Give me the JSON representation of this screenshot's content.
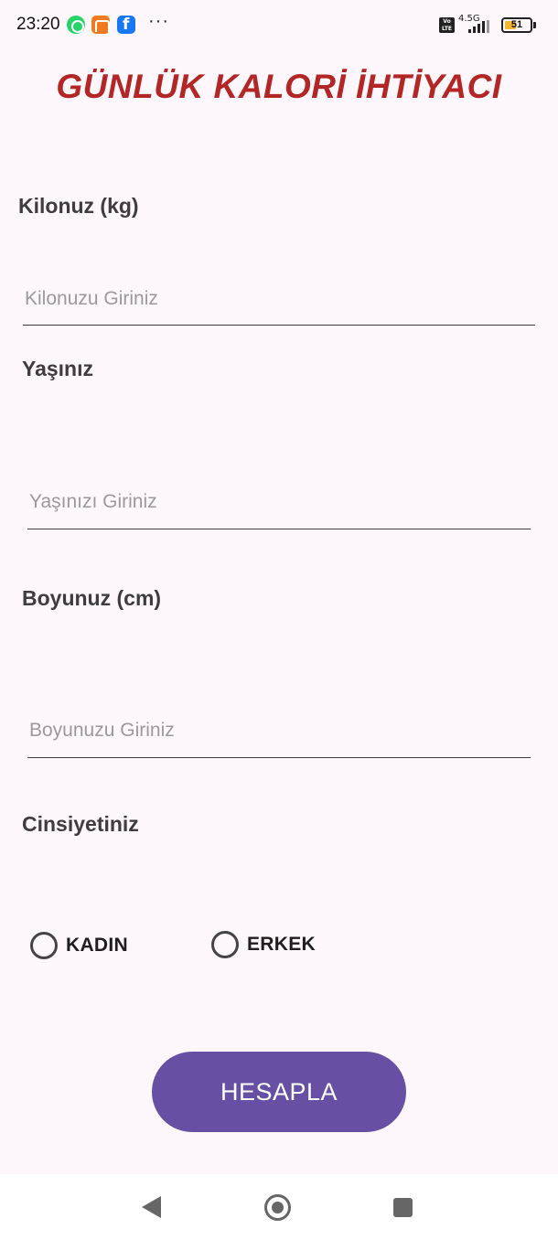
{
  "status_bar": {
    "time": "23:20",
    "notification_icons": [
      "whatsapp-icon",
      "mi-mover-icon",
      "facebook-icon"
    ],
    "more_indicator": "···",
    "volte": "Vo LTE",
    "network": "4.5G",
    "battery": "51",
    "battery_color": "#f2b632"
  },
  "title": "GÜNLÜK KALORİ İHTİYACI",
  "weight": {
    "label": "Kilonuz (kg)",
    "placeholder": "Kilonuzu Giriniz",
    "value": ""
  },
  "age": {
    "label": "Yaşınız",
    "placeholder": "Yaşınızı Giriniz",
    "value": ""
  },
  "height": {
    "label": "Boyunuz (cm)",
    "placeholder": "Boyunuzu Giriniz",
    "value": ""
  },
  "gender": {
    "label": "Cinsiyetiniz",
    "options": [
      {
        "label": "KADIN",
        "selected": false
      },
      {
        "label": "ERKEK",
        "selected": false
      }
    ]
  },
  "button": {
    "label": "HESAPLA",
    "color": "#6750a4"
  },
  "colors": {
    "title": "#b32626",
    "background": "#fdf6fb"
  },
  "nav_bar": {
    "icons": [
      "back-icon",
      "home-icon",
      "recents-icon"
    ]
  }
}
